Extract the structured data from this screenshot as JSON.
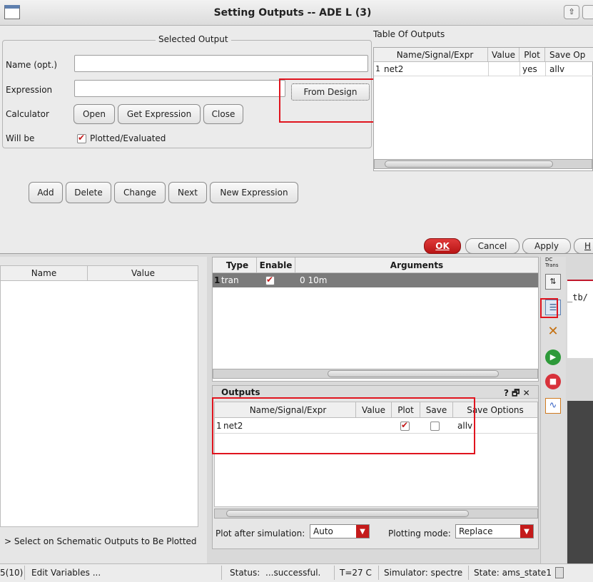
{
  "dialog": {
    "title": "Setting Outputs -- ADE L (3)",
    "selected_output": {
      "group_label": "Selected Output",
      "name_label": "Name (opt.)",
      "expression_label": "Expression",
      "from_design": "From Design",
      "calculator_label": "Calculator",
      "open": "Open",
      "get_expression": "Get Expression",
      "close": "Close",
      "will_be_label": "Will be",
      "plotted_evaluated": "Plotted/Evaluated"
    },
    "actions": {
      "add": "Add",
      "delete": "Delete",
      "change": "Change",
      "next": "Next",
      "new_expression": "New Expression"
    },
    "table_of_outputs": {
      "label": "Table Of Outputs",
      "columns": [
        "Name/Signal/Expr",
        "Value",
        "Plot",
        "Save Op"
      ],
      "rows": [
        {
          "index": "1",
          "name": "net2",
          "value": "",
          "plot": "yes",
          "save": "allv"
        }
      ]
    },
    "footer": {
      "ok": "OK",
      "cancel": "Cancel",
      "apply": "Apply",
      "help": "H"
    }
  },
  "variables_panel": {
    "col_name": "Name",
    "col_value": "Value",
    "hint": "> Select on Schematic Outputs to Be Plotted"
  },
  "analyses": {
    "columns": [
      "Type",
      "Enable",
      "Arguments"
    ],
    "rows": [
      {
        "index": "1",
        "type": "tran",
        "enabled": true,
        "arguments": "0 10m"
      }
    ]
  },
  "outputs_panel": {
    "title": "Outputs",
    "title_controls": "? 🗗 ✕",
    "columns": [
      "Name/Signal/Expr",
      "Value",
      "Plot",
      "Save",
      "Save Options"
    ],
    "rows": [
      {
        "index": "1",
        "name": "net2",
        "value": "",
        "plot": true,
        "save": false,
        "save_options": "allv"
      }
    ],
    "plot_after_label": "Plot after simulation:",
    "plot_after_value": "Auto",
    "plotting_mode_label": "Plotting mode:",
    "plotting_mode_value": "Replace"
  },
  "right_strip": {
    "dc_trans_label": "DC Trans",
    "path_fragment": "_tb/"
  },
  "status_bar": {
    "left_count": "5(10)",
    "edit_variables": "Edit Variables ...",
    "status_label": "Status:",
    "status_value": "...successful.",
    "temperature": "T=27 C",
    "simulator": "Simulator: spectre",
    "state": "State: ams_state1"
  },
  "colors": {
    "highlight_red": "#e0141e",
    "ok_button": "#cc1a1a",
    "selected_row": "#7b7b7b"
  }
}
